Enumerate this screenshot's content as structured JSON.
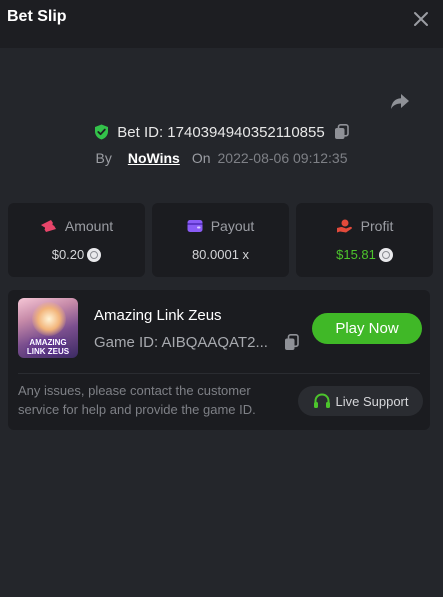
{
  "header": {
    "title": "Bet Slip"
  },
  "bet": {
    "id_label": "Bet ID: 1740394940352110855",
    "by_label": "By",
    "username": "NoWins",
    "on_label": "On",
    "datetime": "2022-08-06 09:12:35"
  },
  "stats": {
    "amount": {
      "label": "Amount",
      "value": "$0.20"
    },
    "payout": {
      "label": "Payout",
      "value": "80.0001 x"
    },
    "profit": {
      "label": "Profit",
      "value": "$15.81"
    }
  },
  "game": {
    "thumb_line1": "AMAZING",
    "thumb_line2": "LINK ZEUS",
    "name": "Amazing Link Zeus",
    "id_text": "Game ID: AIBQAAQAT2...",
    "play_label": "Play Now"
  },
  "support": {
    "note": "Any issues, please contact the customer service for help and provide the game ID.",
    "button_label": "Live Support"
  },
  "colors": {
    "background": "#24262b",
    "card": "#1b1c20",
    "accent_green": "#40b827",
    "profit_green": "#4cc42c",
    "amount_pink": "#e8456a",
    "payout_purple": "#8a5cf6",
    "profit_red": "#e24a3b"
  },
  "icons": {
    "close": "close-icon",
    "share": "share-icon",
    "shield": "shield-check-icon",
    "copy": "copy-icon",
    "amount": "ticket-icon",
    "payout": "wallet-icon",
    "profit": "hand-coin-icon",
    "coin": "coin-icon",
    "headset": "headset-icon"
  }
}
